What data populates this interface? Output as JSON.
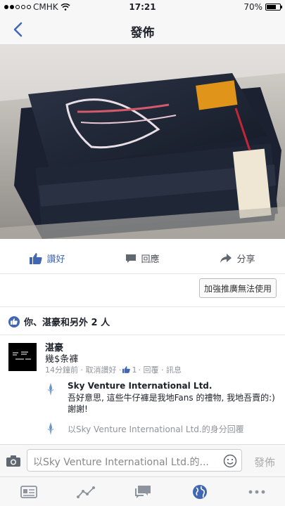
{
  "status_bar": {
    "carrier": "CMHK",
    "time": "17:21",
    "battery": "70%",
    "battery_level": 0.7
  },
  "nav": {
    "title": "發佈"
  },
  "actions": {
    "like": "讚好",
    "comment": "回應",
    "share": "分享"
  },
  "boost_button": "加強推廣無法使用",
  "likers": "你、湛豪和另外 2 人",
  "comment": {
    "name": "湛豪",
    "text": "幾$条褲",
    "meta_time": "14分鐘前 · 取消讚好 · ",
    "meta_count": "1",
    "meta_rest": " · 回覆 · 訊息"
  },
  "reply": {
    "name": "Sky Venture International Ltd.",
    "text": "吾好意思, 這些牛仔褲是我地Fans 的禮物, 我地吾賣的:) 謝謝!"
  },
  "reply_as": "以Sky Venture International Ltd.的身分回覆",
  "composer": {
    "placeholder": "以Sky Venture International Ltd.的...",
    "send": "發佈"
  },
  "colors": {
    "accent": "#4267b2",
    "muted": "#90949c"
  }
}
